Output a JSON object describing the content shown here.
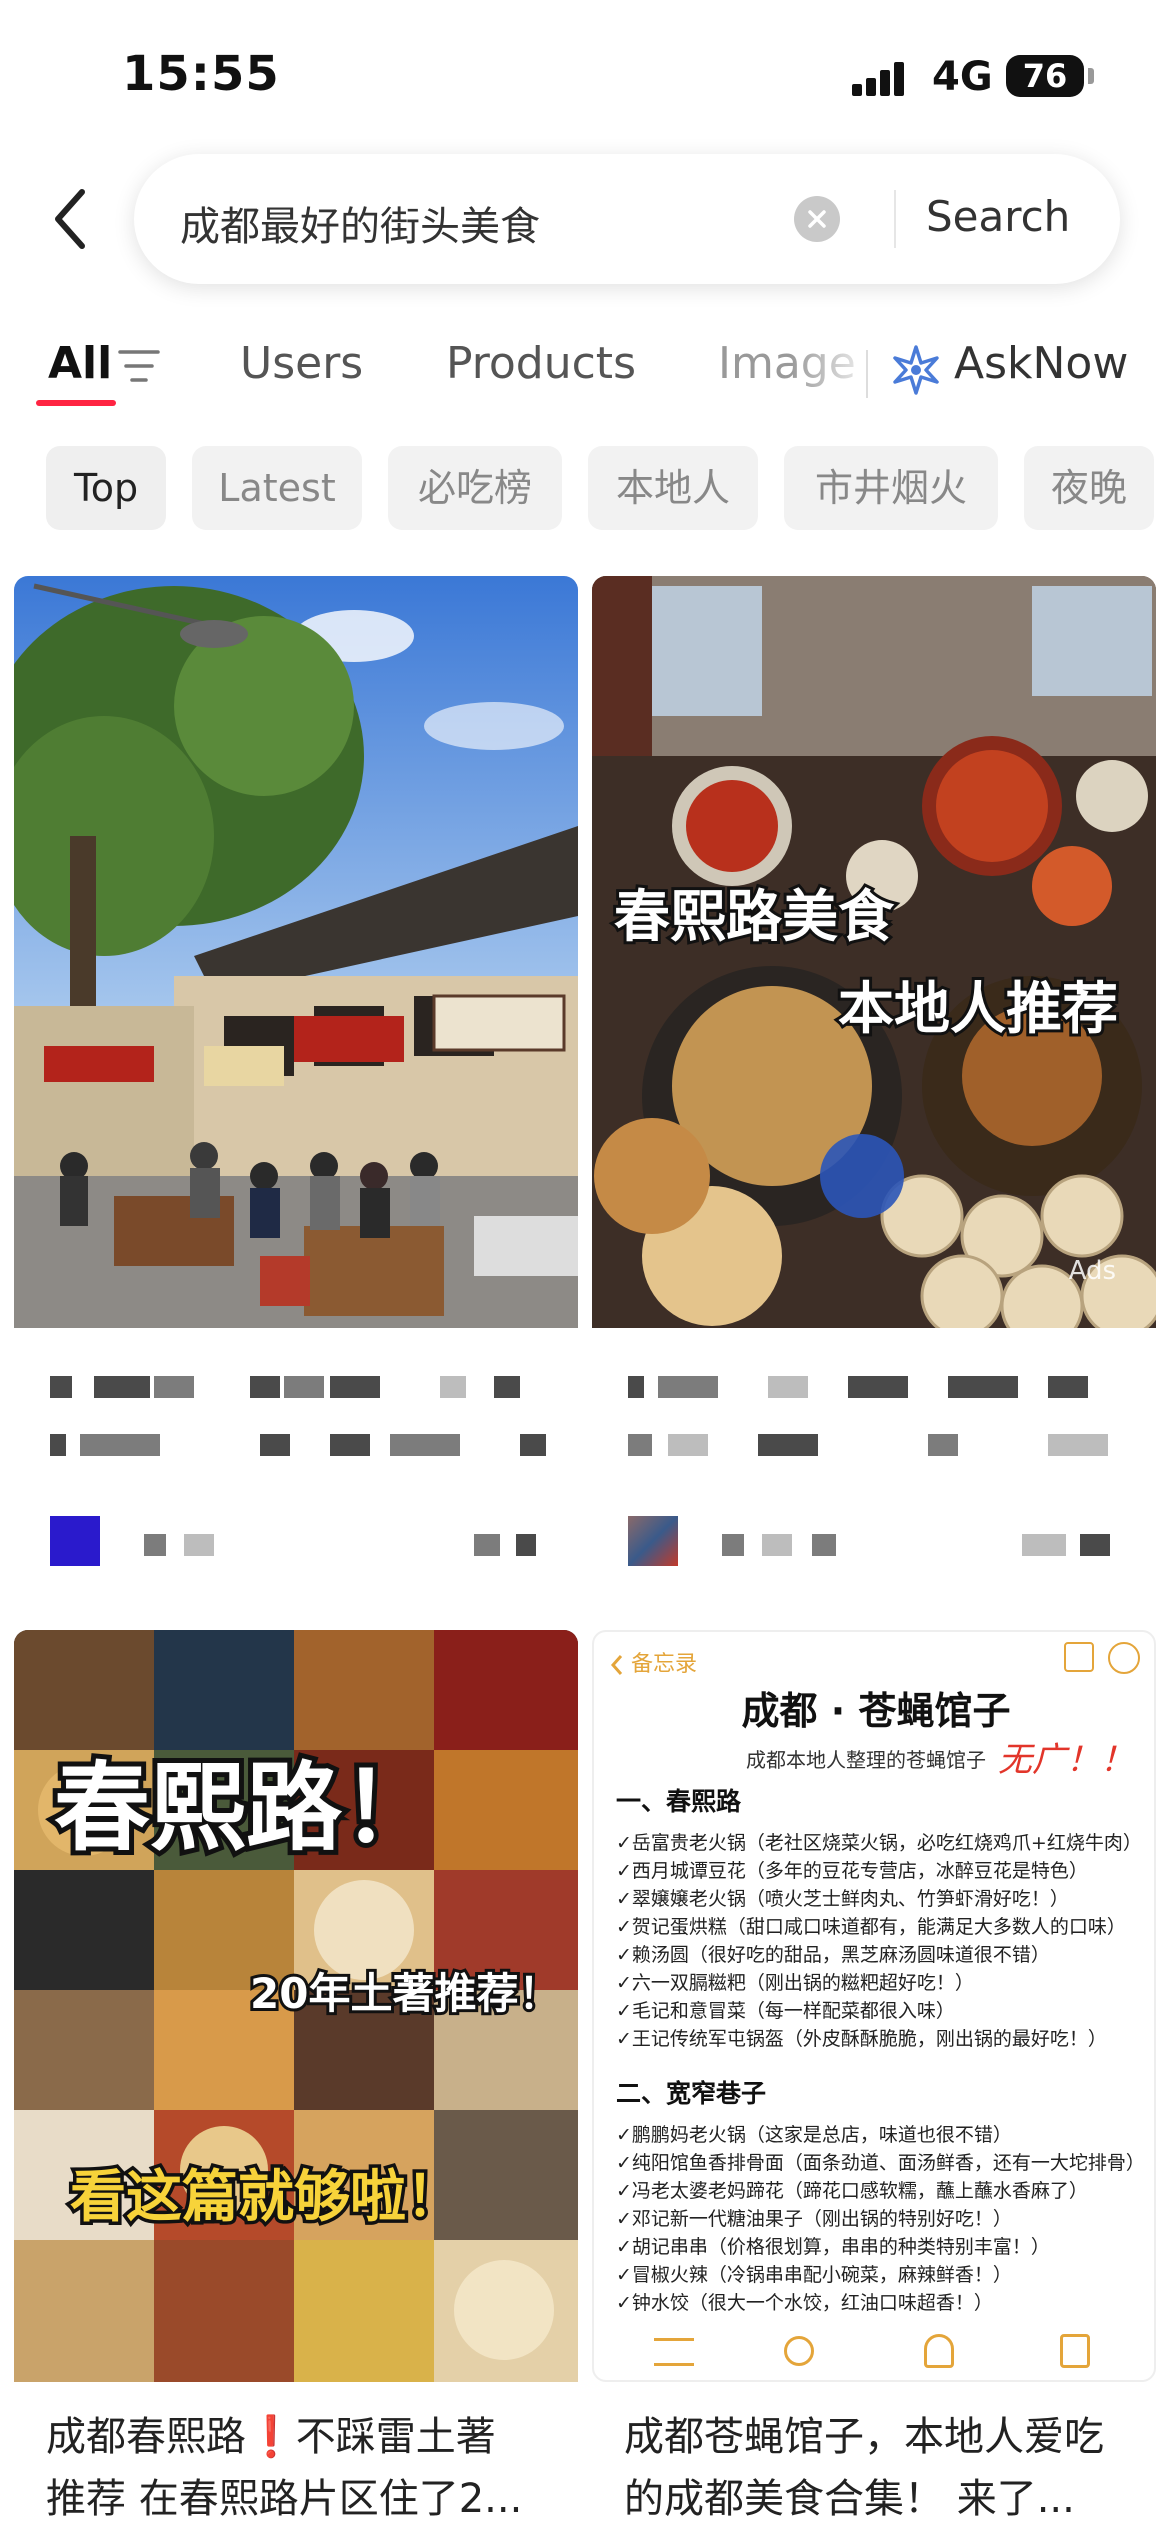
{
  "status_bar": {
    "time": "15:55",
    "network": "4G",
    "battery": "76"
  },
  "search": {
    "query": "成都最好的街头美食",
    "button_label": "Search"
  },
  "tabs": [
    {
      "label": "All",
      "active": true
    },
    {
      "label": "Users"
    },
    {
      "label": "Products"
    },
    {
      "label": "Image"
    },
    {
      "label": "AskNow"
    }
  ],
  "chips": [
    "Top",
    "Latest",
    "必吃榜",
    "本地人",
    "市井烟火",
    "夜晚"
  ],
  "cards": {
    "card2": {
      "overlay_line1": "春熙路美食",
      "overlay_line2": "本地人推荐",
      "ad_label": "Ads"
    },
    "card3": {
      "overlay_line1": "春熙路！",
      "overlay_line2": "20年土著推荐！",
      "overlay_line3": "看这篇就够啦！",
      "title_line1": "成都春熙路❗不踩雷土著",
      "title_line2": "推荐 在春熙路片区住了2..."
    },
    "card4": {
      "memo_back": "备忘录",
      "memo_title": "成都 · 苍蝇馆子",
      "memo_subtitle": "成都本地人整理的苍蝇馆子",
      "memo_handwritten": "无广！！",
      "section1": "一、春熙路",
      "section1_items": [
        "✓岳富贵老火锅（老社区烧菜火锅，必吃红烧鸡爪+红烧牛肉）",
        "✓西月城谭豆花（多年的豆花专营店，冰醉豆花是特色）",
        "✓翠嬢嬢老火锅（喷火芝士鲜肉丸、竹笋虾滑好吃！）",
        "✓贺记蛋烘糕（甜口咸口味道都有，能满足大多数人的口味）",
        "✓赖汤圆（很好吃的甜品，黑芝麻汤圆味道很不错）",
        "✓六一双膈糍粑（刚出锅的糍粑超好吃！）",
        "✓毛记和意冒菜（每一样配菜都很入味）",
        "✓王记传统军屯锅盔（外皮酥酥脆脆，刚出锅的最好吃！）"
      ],
      "section2": "二、宽窄巷子",
      "section2_items": [
        "✓鹏鹏妈老火锅（这家是总店，味道也很不错）",
        "✓纯阳馆鱼香排骨面（面条劲道、面汤鲜香，还有一大坨排骨）",
        "✓冯老太婆老妈蹄花（蹄花口感软糯，蘸上蘸水香麻了）",
        "✓邓记新一代糖油果子（刚出锅的特别好吃！）",
        "✓胡记串串（价格很划算，串串的种类特别丰富！）",
        "✓冒椒火辣（冷锅串串配小碗菜，麻辣鲜香！）",
        "✓钟水饺（很大一个水饺，红油口味超香！）"
      ],
      "title_line1": "成都苍蝇馆子，本地人爱吃",
      "title_line2": "的成都美食合集！ 来了..."
    }
  },
  "colors": {
    "accent": "#ff2442",
    "chip_bg": "#f2f2f2",
    "text": "#222222"
  }
}
